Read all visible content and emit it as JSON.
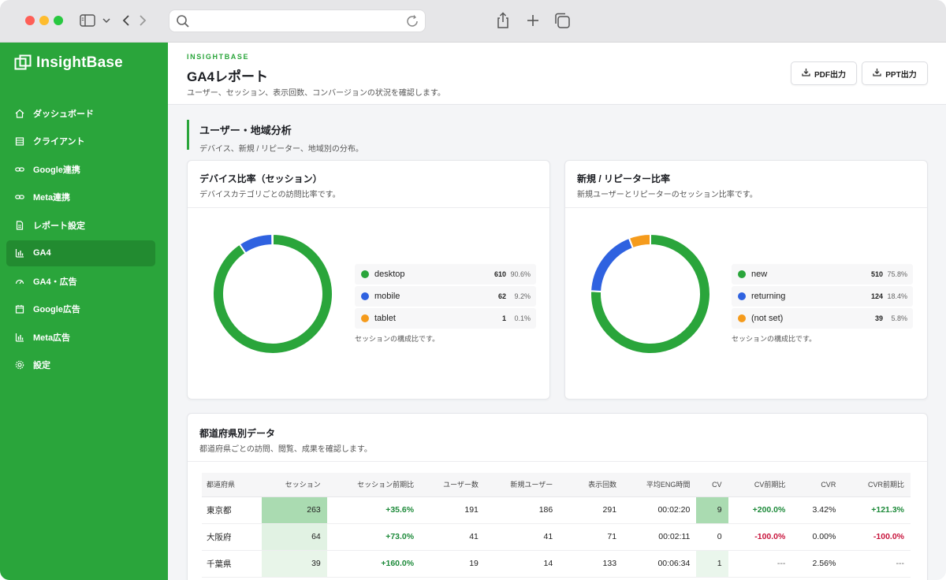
{
  "app": {
    "name": "InsightBase"
  },
  "sidebar": {
    "items": [
      {
        "label": "ダッシュボード",
        "icon": "home-icon"
      },
      {
        "label": "クライアント",
        "icon": "building-icon"
      },
      {
        "label": "Google連携",
        "icon": "link-icon"
      },
      {
        "label": "Meta連携",
        "icon": "link-icon"
      },
      {
        "label": "レポート設定",
        "icon": "document-icon"
      },
      {
        "label": "GA4",
        "icon": "bar-chart-icon",
        "active": true
      },
      {
        "label": "GA4・広告",
        "icon": "gauge-icon"
      },
      {
        "label": "Google広告",
        "icon": "calendar-icon"
      },
      {
        "label": "Meta広告",
        "icon": "bar-chart-icon"
      },
      {
        "label": "設定",
        "icon": "gear-icon"
      }
    ]
  },
  "header": {
    "brand": "INSIGHTBASE",
    "title": "GA4レポート",
    "subtitle": "ユーザー、セッション、表示回数、コンバージョンの状況を確認します。",
    "pdf_label": "PDF出力",
    "ppt_label": "PPT出力"
  },
  "section": {
    "title": "ユーザー・地域分析",
    "subtitle": "デバイス、新規 / リピーター、地域別の分布。"
  },
  "colors": {
    "green": "#2aa53b",
    "blue": "#2f62e0",
    "orange": "#f59b1c"
  },
  "device_card": {
    "title": "デバイス比率（セッション）",
    "subtitle": "デバイスカテゴリごとの訪問比率です。",
    "note": "セッションの構成比です。"
  },
  "newret_card": {
    "title": "新規 / リピーター比率",
    "subtitle": "新規ユーザーとリピーターのセッション比率です。",
    "note": "セッションの構成比です。"
  },
  "chart_data": [
    {
      "type": "pie",
      "title": "デバイス比率（セッション）",
      "categories": [
        "desktop",
        "mobile",
        "tablet"
      ],
      "values": [
        610,
        62,
        1
      ],
      "percents": [
        "90.6%",
        "9.2%",
        "0.1%"
      ],
      "colors": [
        "#2aa53b",
        "#2f62e0",
        "#f59b1c"
      ]
    },
    {
      "type": "pie",
      "title": "新規 / リピーター比率",
      "categories": [
        "new",
        "returning",
        "(not set)"
      ],
      "values": [
        510,
        124,
        39
      ],
      "percents": [
        "75.8%",
        "18.4%",
        "5.8%"
      ],
      "colors": [
        "#2aa53b",
        "#2f62e0",
        "#f59b1c"
      ]
    }
  ],
  "table_card": {
    "title": "都道府県別データ",
    "subtitle": "都道府県ごとの訪問、閲覧、成果を確認します。",
    "columns": [
      "都道府県",
      "セッション",
      "セッション前期比",
      "ユーザー数",
      "新規ユーザー",
      "表示回数",
      "平均ENG時間",
      "CV",
      "CV前期比",
      "CVR",
      "CVR前期比"
    ],
    "rows": [
      [
        "東京都",
        "263",
        "+35.6%",
        "191",
        "186",
        "291",
        "00:02:20",
        "9",
        "+200.0%",
        "3.42%",
        "+121.3%"
      ],
      [
        "大阪府",
        "64",
        "+73.0%",
        "41",
        "41",
        "71",
        "00:02:11",
        "0",
        "-100.0%",
        "0.00%",
        "-100.0%"
      ],
      [
        "千葉県",
        "39",
        "+160.0%",
        "19",
        "14",
        "133",
        "00:06:34",
        "1",
        "---",
        "2.56%",
        "---"
      ]
    ],
    "session_heat": [
      1.0,
      0.24,
      0.15
    ],
    "cv_heat": [
      1.0,
      0.0,
      0.11
    ]
  }
}
